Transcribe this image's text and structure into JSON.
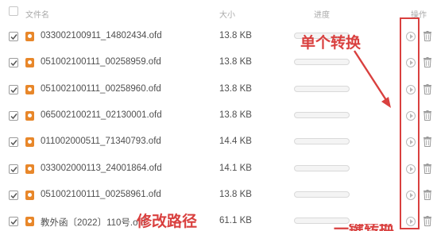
{
  "header": {
    "name": "文件名",
    "size": "大小",
    "progress": "进度",
    "action": "操作"
  },
  "rows": [
    {
      "name": "033002100911_14802434.ofd",
      "size": "13.8 KB",
      "progress": 0
    },
    {
      "name": "051002100111_00258959.ofd",
      "size": "13.8 KB",
      "progress": 0
    },
    {
      "name": "051002100111_00258960.ofd",
      "size": "13.8 KB",
      "progress": 0
    },
    {
      "name": "065002100211_02130001.ofd",
      "size": "13.8 KB",
      "progress": 0
    },
    {
      "name": "011002000511_71340793.ofd",
      "size": "14.4 KB",
      "progress": 0
    },
    {
      "name": "033002000113_24001864.ofd",
      "size": "14.1 KB",
      "progress": 0
    },
    {
      "name": "051002100111_00258961.ofd",
      "size": "13.8 KB",
      "progress": 0
    },
    {
      "name": "教外函〔2022〕110号.ofd",
      "size": "61.1 KB",
      "progress": 0
    }
  ],
  "annotations": {
    "single_convert": "单个转换",
    "modify_path": "修改路径",
    "one_click": "一键转换",
    "color": "#d9403f"
  },
  "icons": {
    "file": "ofd-file-icon",
    "action": "play-circle-icon",
    "delete": "trash-icon"
  }
}
